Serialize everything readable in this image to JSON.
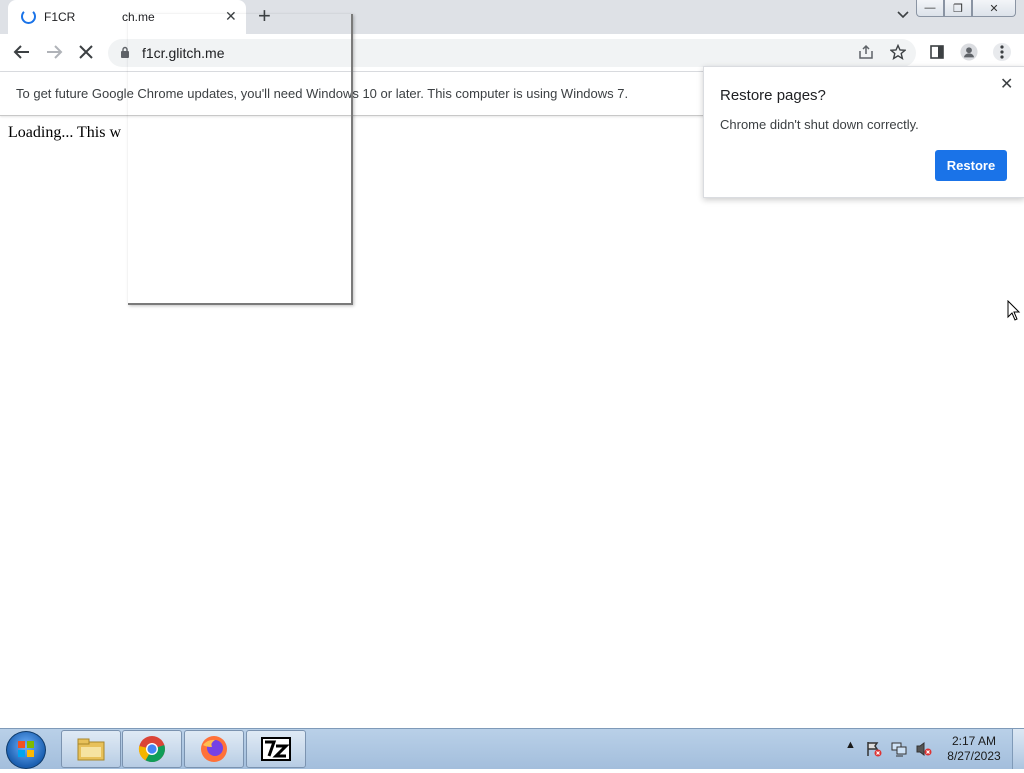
{
  "tabstrip": {
    "tab_title": "F1CR",
    "tab_title_overlap": "ch.me",
    "close_glyph": "✕",
    "new_tab_glyph": "+",
    "tab_search_glyph": "⌄",
    "window_buttons": {
      "minimize": "—",
      "restore": "❐",
      "close": "✕"
    }
  },
  "toolbar": {
    "url": "f1cr.glitch.me"
  },
  "infobar": {
    "text": "To get future Google Chrome updates, you'll need Windows 10 or later. This computer is using Windows 7."
  },
  "page": {
    "loading_text": "Loading... This w"
  },
  "restore_bubble": {
    "title": "Restore pages?",
    "message": "Chrome didn't shut down correctly.",
    "button_label": "Restore",
    "close_glyph": "✕"
  },
  "taskbar": {
    "tray_arrow": "▲",
    "time": "2:17 AM",
    "date": "8/27/2023"
  },
  "colors": {
    "accent": "#1a73e8",
    "tabstrip_bg": "#dee1e6",
    "taskbar_bg": "#a3bedc"
  },
  "icons": [
    "back-arrow-icon",
    "forward-arrow-icon",
    "stop-icon",
    "lock-icon",
    "share-icon",
    "star-icon",
    "side-panel-icon",
    "profile-icon",
    "menu-dots-icon",
    "windows-start-icon",
    "file-explorer-icon",
    "chrome-icon",
    "firefox-icon",
    "7zip-icon"
  ]
}
